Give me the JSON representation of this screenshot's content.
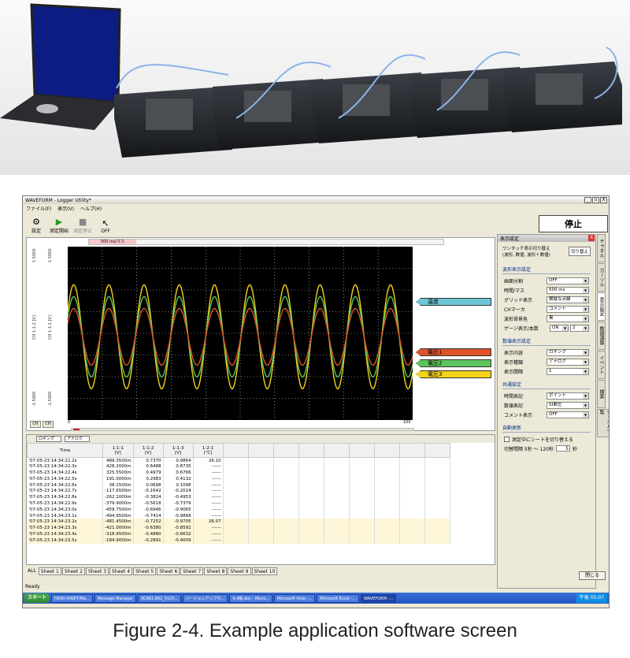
{
  "window": {
    "title": "WAVEFORM - Logger Utility*",
    "controls": [
      "_",
      "▫",
      "X"
    ]
  },
  "menu": [
    {
      "label": "ファイル(F)"
    },
    {
      "label": "表示(V)"
    },
    {
      "label": "ヘルプ(H)"
    }
  ],
  "toolbar": {
    "items": [
      {
        "label": "設定",
        "icon": "gear-icon"
      },
      {
        "label": "測定開始",
        "icon": "play-icon"
      },
      {
        "label": "測定停止",
        "icon": "stop-icon"
      },
      {
        "label": "OFF",
        "icon": "cursor-icon"
      }
    ],
    "status": "停止"
  },
  "graph": {
    "time_scale": "500 ms/マス",
    "axis_left_label": "CH 1-1-2 [V]",
    "axis_right_label": "CH 1-1-1 [V]",
    "y_top": "1.5000",
    "y_bottom": "-1.5000",
    "x_start": "0",
    "x_end": "100",
    "ch_buttons": [
      "CH",
      "CH"
    ],
    "legends": [
      {
        "label": "温度",
        "color": "#6ec6d6"
      },
      {
        "label": "電圧1",
        "color": "#e0522a"
      },
      {
        "label": "電圧2",
        "color": "#5cc45c"
      },
      {
        "label": "電圧3",
        "color": "#f2d21b"
      }
    ],
    "waves": [
      {
        "color": "#f2d21b",
        "amp": 1.1
      },
      {
        "color": "#5cc45c",
        "amp": 0.85
      },
      {
        "color": "#e0522a",
        "amp": 0.6
      }
    ]
  },
  "panel": {
    "title": "表示設定",
    "close": "X",
    "switch_text": "ワンタッチ表示切り替え\n(波形, 数値, 波形＋数値)",
    "switch_button": "切り替え",
    "sec1": "波形表示設定",
    "rows1": [
      {
        "label": "画面分割",
        "value": "OFF"
      },
      {
        "label": "時間/マス",
        "value": "500 ms"
      },
      {
        "label": "グリッド表示",
        "value": "横縦な点線"
      },
      {
        "label": "CHマーカ",
        "value": "コメント"
      },
      {
        "label": "波形背景色",
        "value": "黒"
      },
      {
        "label": "ゲージ表示/本数",
        "value": "ON",
        "value2": "2"
      }
    ],
    "sec2": "数値表示設定",
    "rows2": [
      {
        "label": "表示内容",
        "value": "ロギング"
      },
      {
        "label": "表示種類",
        "value": "アナログ"
      },
      {
        "label": "表示間隔",
        "value": "1"
      }
    ],
    "sec3": "共通設定",
    "rows3": [
      {
        "label": "時間表記",
        "value": "ポイント"
      },
      {
        "label": "数値表記",
        "value": "SI単位"
      },
      {
        "label": "コメント表示",
        "value": "OFF"
      }
    ],
    "sec4": "自動更新",
    "auto_check": "測定中にシートを切り替える",
    "auto_interval_label": "切替間隔 5秒 ～ 120秒",
    "auto_interval_value": "5",
    "auto_interval_unit": "秒",
    "close_button": "閉じる"
  },
  "vtabs": [
    "チャネル",
    "カーソル",
    "表示設定",
    "数値演算",
    "イベント",
    "検索",
    "チャネル一覧"
  ],
  "table": {
    "mode1": "ロギング",
    "mode2": "アナログ",
    "time_header": "Time",
    "columns": [
      {
        "name": "1-1-1",
        "unit": "[V]"
      },
      {
        "name": "1-1-2",
        "unit": "[V]"
      },
      {
        "name": "1-1-3",
        "unit": "[V]"
      },
      {
        "name": "1-2-1",
        "unit": "[℃]"
      }
    ],
    "rows": [
      [
        "'07-05-23 14:34:22.2s",
        "489.3500m",
        "0.7370",
        "0.9864",
        "26.10"
      ],
      [
        "'07-05-23 14:34:22.3s",
        "428.2000m",
        "0.6488",
        "0.8735",
        "------"
      ],
      [
        "'07-05-23 14:34:22.4s",
        "325.5500m",
        "0.4979",
        "0.6766",
        "------"
      ],
      [
        "'07-05-23 14:34:22.5s",
        "191.0000m",
        "0.2983",
        "0.4132",
        "------"
      ],
      [
        "'07-05-23 14:34:22.6s",
        "38.1500m",
        "0.0698",
        "0.1098",
        "------"
      ],
      [
        "'07-05-23 14:34:22.7s",
        "-117.6500m",
        "-0.1642",
        "-0.2024",
        "------"
      ],
      [
        "'07-05-23 14:34:22.8s",
        "-262.1000m",
        "-0.3824",
        "-0.4953",
        "------"
      ],
      [
        "'07-05-23 14:34:22.9s",
        "-379.9000m",
        "-0.5618",
        "-0.7379",
        "------"
      ],
      [
        "'07-05-23 14:34:23.0s",
        "-459.7500m",
        "-0.6946",
        "-0.9065",
        "------"
      ],
      [
        "'07-05-23 14:34:23.1s",
        "-494.9500m",
        "-0.7414",
        "-0.9868",
        "------"
      ],
      [
        "'07-05-23 14:34:23.2s",
        "-481.4500m",
        "-0.7252",
        "-0.9705",
        "26.07"
      ],
      [
        "'07-05-23 14:34:23.3s",
        "-421.0000m",
        "-0.6380",
        "-0.8592",
        "------"
      ],
      [
        "'07-05-23 14:34:23.4s",
        "-318.9500m",
        "-0.4880",
        "-0.6632",
        "------"
      ],
      [
        "'07-05-23 14:34:23.5s",
        "-184.9000m",
        "-0.2891",
        "-0.4009",
        "------"
      ]
    ]
  },
  "sheets": [
    "ALL",
    "Sheet 1",
    "Sheet 2",
    "Sheet 3",
    "Sheet 4",
    "Sheet 5",
    "Sheet 6",
    "Sheet 7",
    "Sheet 8",
    "Sheet 9",
    "Sheet 10"
  ],
  "statusbar": "Ready",
  "taskbar": {
    "start": "スタート",
    "tasks": [
      "HIOKI-HiNET/Ma...",
      "Message Manager",
      "XC661.662_5\\CH...",
      "バージョンアップガ...",
      "9.4版.doc - Micro...",
      "Microsoft Visio -...",
      "Microsoft Excel -...",
      "WAVEFORM -..."
    ],
    "clock": "午後 05:07"
  },
  "caption": "Figure 2-4. Example application software screen"
}
